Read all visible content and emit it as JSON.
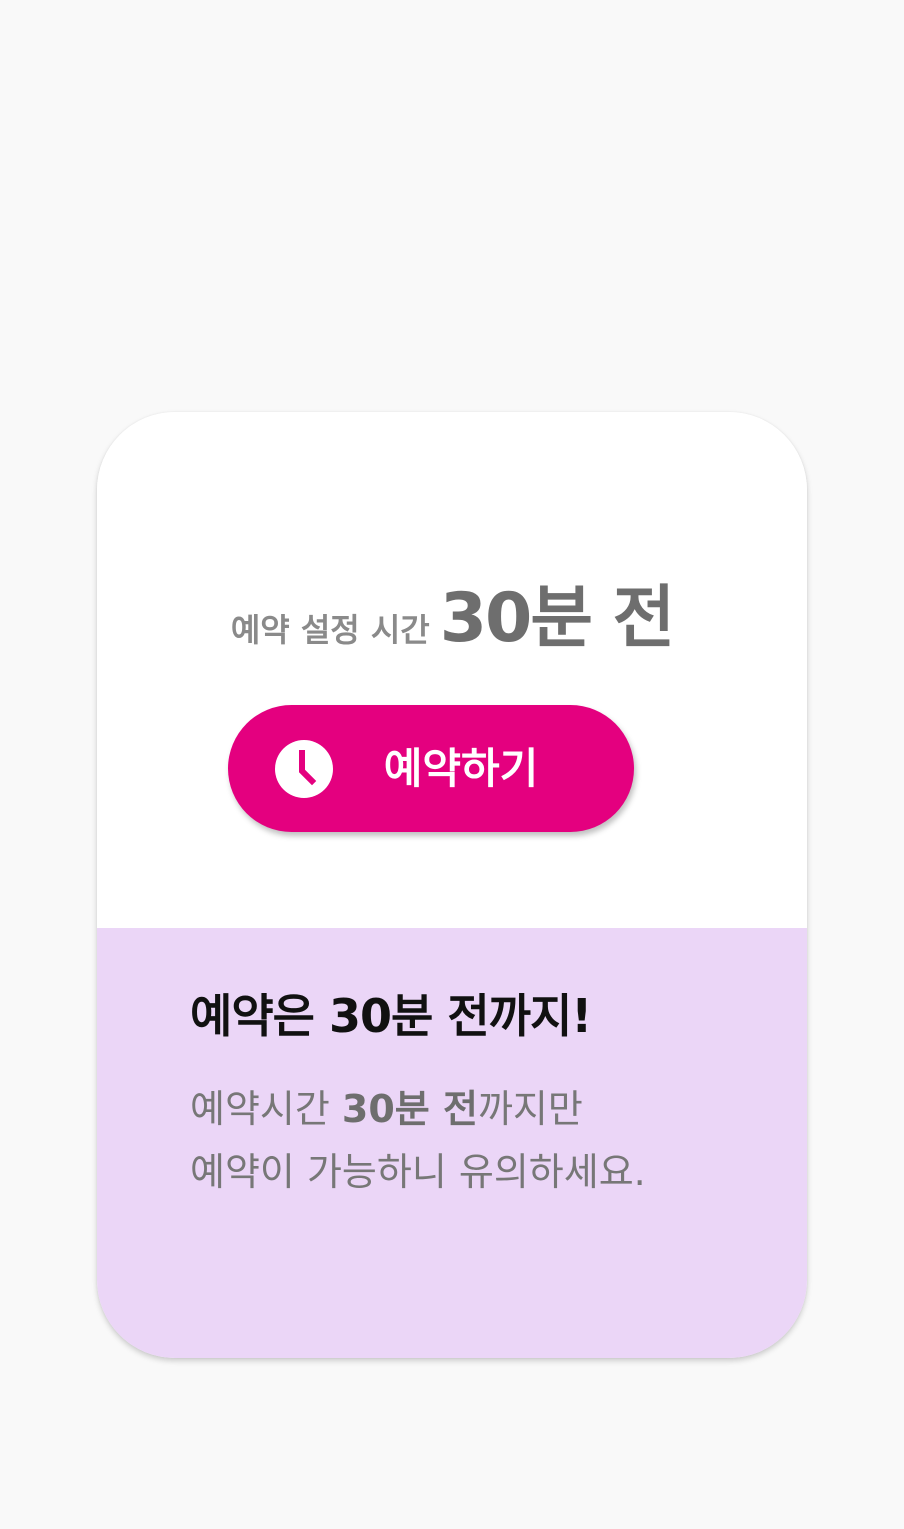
{
  "card": {
    "header": {
      "label": "예약 설정 시간",
      "value": "30분 전"
    },
    "reserve_button": {
      "label": "예약하기",
      "icon": "clock-icon"
    },
    "notice": {
      "title": "예약은 30분 전까지!",
      "line1_prefix": "예약시간 ",
      "line1_emphasis": "30분 전",
      "line1_suffix": "까지만",
      "line2": "예약이 가능하니 유의하세요."
    }
  },
  "colors": {
    "accent": "#e4007f",
    "notice_bg": "#ebd6f7",
    "page_bg": "#f9f9f9"
  }
}
